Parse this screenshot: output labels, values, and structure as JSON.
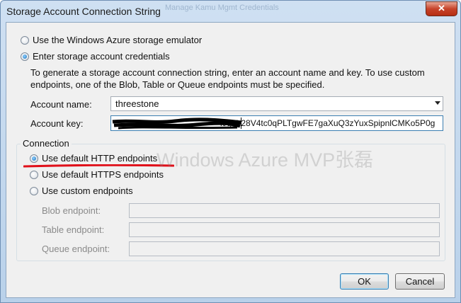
{
  "window": {
    "title": "Storage Account Connection String",
    "background_ghost_text": "Manage Kamu Mgmt Credentials",
    "close_glyph": "✕"
  },
  "options": {
    "emulator_label": "Use the Windows Azure storage emulator",
    "credentials_label": "Enter storage account credentials",
    "selected": "credentials"
  },
  "instructions": {
    "line1": "To generate a storage account connection string, enter an account name and key.  To use custom",
    "line2": "endpoints,  one of the Blob, Table or Queue endpoints must be specified."
  },
  "account": {
    "name_label": "Account name:",
    "name_value": "threestone",
    "key_label": "Account key:",
    "key_value": "ObscuredKeyValue/gnh28V4tc0qPLTgwFE7gaXuQ3zYuxSpipnlCMKo5P0g",
    "key_visible_suffix": "k/gnh28V4tc0qPLTgwFE7gaXuQ3zYuxSpipnlCMKo5P0g"
  },
  "connection": {
    "group_label": "Connection",
    "http_label": "Use default HTTP endpoints",
    "https_label": "Use default HTTPS endpoints",
    "custom_label": "Use custom endpoints",
    "selected": "http",
    "blob_label": "Blob endpoint:",
    "table_label": "Table endpoint:",
    "queue_label": "Queue endpoint:",
    "blob_value": "",
    "table_value": "",
    "queue_value": ""
  },
  "watermark": "Windows Azure MVP张磊",
  "buttons": {
    "ok": "OK",
    "cancel": "Cancel"
  },
  "colors": {
    "accent_focus": "#3c7fb1",
    "annotation_red": "#e0101a",
    "close_red": "#c7432a"
  }
}
